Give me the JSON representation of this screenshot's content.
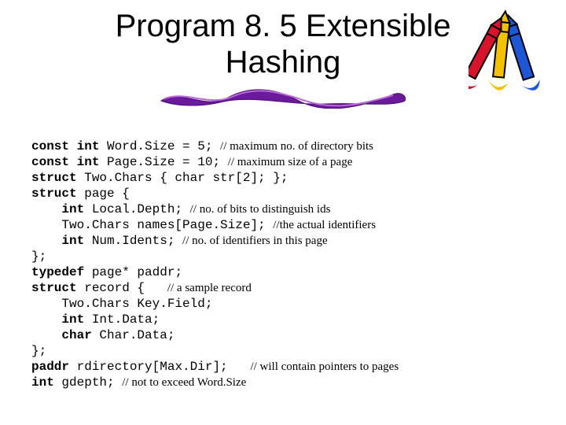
{
  "title_line1": "Program 8. 5 Extensible",
  "title_line2": "Hashing",
  "code": {
    "l1a": "const int",
    "l1b": " Word.Size = 5; ",
    "l1c": "// maximum no. of directory bits",
    "l2a": "const int",
    "l2b": " Page.Size = 10; ",
    "l2c": "// maximum size of a page",
    "l3a": "struct",
    "l3b": " Two.Chars { char str[2]; };",
    "l4a": "struct",
    "l4b": " page {",
    "l5a": "    int",
    "l5b": " Local.Depth; ",
    "l5c": "// no. of bits to distinguish ids",
    "l6b": "    Two.Chars names[Page.Size]; ",
    "l6c": "//the actual identifiers",
    "l7a": "    int",
    "l7b": " Num.Idents; ",
    "l7c": "// no. of identifiers in this page",
    "l8b": "};",
    "l9a": "typedef",
    "l9b": " page* paddr;",
    "l10a": "struct",
    "l10b": " record {   ",
    "l10c": "// a sample record",
    "l11b": "    Two.Chars Key.Field;",
    "l12a": "    int",
    "l12b": " Int.Data;",
    "l13a": "    char",
    "l13b": " Char.Data;",
    "l14b": "};",
    "l15a": "paddr",
    "l15b": " rdirectory[Max.Dir];   ",
    "l15c": "// will contain pointers to pages",
    "l16a": "int",
    "l16b": " gdepth; ",
    "l16c": "// not to exceed Word.Size"
  }
}
